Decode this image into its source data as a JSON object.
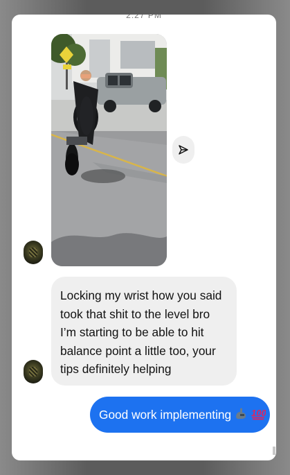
{
  "status_bar": {
    "time": "2:27 PM"
  },
  "incoming_message": {
    "text": "Locking my wrist how you said took that shit to the level bro I’m starting to be able to hit balance point a little too, your tips definitely helping"
  },
  "outgoing_message": {
    "text": "Good work implementing",
    "emojis": [
      "flexed-biceps",
      "hundred-points"
    ]
  },
  "video": {
    "content": "motorcycle-wheelie-photo"
  },
  "icons": {
    "share": "send-paper-plane-icon"
  },
  "colors": {
    "outgoing_bubble": "#1d72f0",
    "incoming_bubble": "#efefef"
  }
}
